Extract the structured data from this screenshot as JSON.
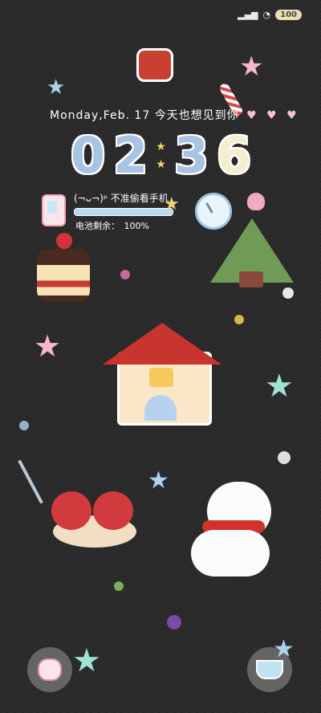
{
  "status_bar": {
    "battery_level": "100"
  },
  "lockscreen": {
    "date_text": "Monday,Feb. 17",
    "message": "今天也想见到你",
    "hearts": "♥ ♥ ♥",
    "clock": {
      "h1": "0",
      "h2": "2",
      "m1": "3",
      "m2": "6"
    }
  },
  "battery_widget": {
    "tease": "(¬ᴗ¬)ᵖ 不准偷看手机",
    "label": "电池剩余：",
    "percent_text": "100%",
    "level": 100
  },
  "colors": {
    "clock_blue": "#a9c3e2",
    "clock_cream": "#f4eecf",
    "heart_pink": "#f6c2cf",
    "star_pink": "#f6b6cf",
    "star_blue": "#a8d4ec",
    "star_mint": "#9fe3d2"
  },
  "bottom_shortcuts": {
    "left": "apple-icon",
    "right": "teacup-icon"
  }
}
